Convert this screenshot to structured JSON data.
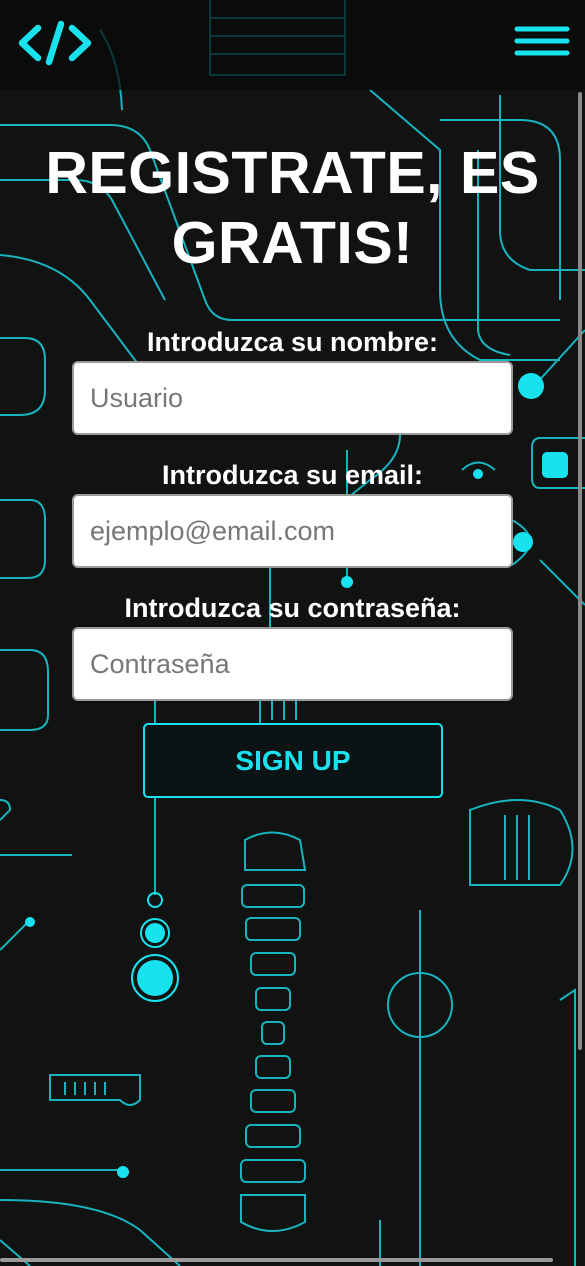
{
  "header": {
    "logo_icon": "code-brackets-icon",
    "menu_icon": "hamburger-menu-icon"
  },
  "form": {
    "title_line1": "REGISTRATE, ES",
    "title_line2": "GRATIS!",
    "name_label": "Introduzca su nombre:",
    "name_placeholder": "Usuario",
    "email_label": "Introduzca su email:",
    "email_placeholder": "ejemplo@email.com",
    "password_label": "Introduzca su contraseña:",
    "password_placeholder": "Contraseña",
    "submit_label": "SIGN UP"
  },
  "colors": {
    "accent": "#19e2ef",
    "background": "#111212",
    "text": "#ffffff"
  }
}
